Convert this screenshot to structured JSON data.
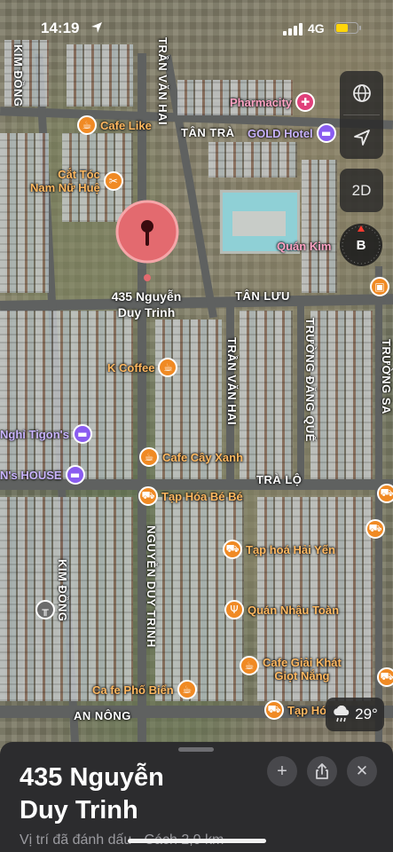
{
  "status_bar": {
    "time": "14:19",
    "network": "4G",
    "battery_level": 0.55
  },
  "map_controls": {
    "map_style_icon": "globe-icon",
    "location_icon": "location-arrow-icon",
    "view_mode": "2D",
    "compass": "B"
  },
  "streets": {
    "kim_dong_top": "KIM ĐỒNG",
    "tran_van_hai_top": "TRẦN VĂN HAI",
    "tan_tra": "TÂN TRÀ",
    "tan_luu": "TÂN LƯU",
    "tran_van_hai_mid": "TRẦN VĂN HAI",
    "truong_dang_que": "TRƯỜNG ĐĂNG QUẾ",
    "truong_sa": "TRƯỜNG SA",
    "tra_lo": "TRÀ LỘ",
    "kim_dong_bottom": "KIM ĐỒNG",
    "nguyen_duy_trinh": "NGUYỄN DUY TRINH",
    "an_nong": "AN NÔNG"
  },
  "pois": {
    "cafe_like": "Cafe Like",
    "pharmacity": "Pharmacity",
    "gold_hotel": "GOLD Hotel",
    "cat_toc": "Cắt Tóc\nNam Nữ Huệ",
    "quan_kim": "Quán Kim",
    "k_coffee": "K Coffee",
    "nghi_tigon": "Nghỉ Tigon's",
    "ns_house": "N's HOUSE",
    "cafe_cay_xanh": "Cafe Cây Xanh",
    "tap_hoa_be_be": "Tạp Hóa Bé Bé",
    "tap_hoa_hai_yen": "Tạp hoá Hải Yến",
    "quan_nhau_toan": "Quán Nhậu Toàn",
    "cafe_giai_khat": "Cafe Giải Khát\nGiọt Nắng",
    "cafe_pho_bien": "Ca fe Phố Biển",
    "tap_ho": "Tạp Hó"
  },
  "dropped_pin": {
    "label": "435 Nguyễn\nDuy Trinh"
  },
  "weather": {
    "icon": "rain-cloud-icon",
    "temperature": "29°"
  },
  "sheet": {
    "title": "435 Nguyễn\nDuy Trinh",
    "subtitle": "Vị trí đã đánh dấu · Cách 2,0 km",
    "add_label": "+",
    "share_icon": "share-icon",
    "close_label": "✕"
  }
}
